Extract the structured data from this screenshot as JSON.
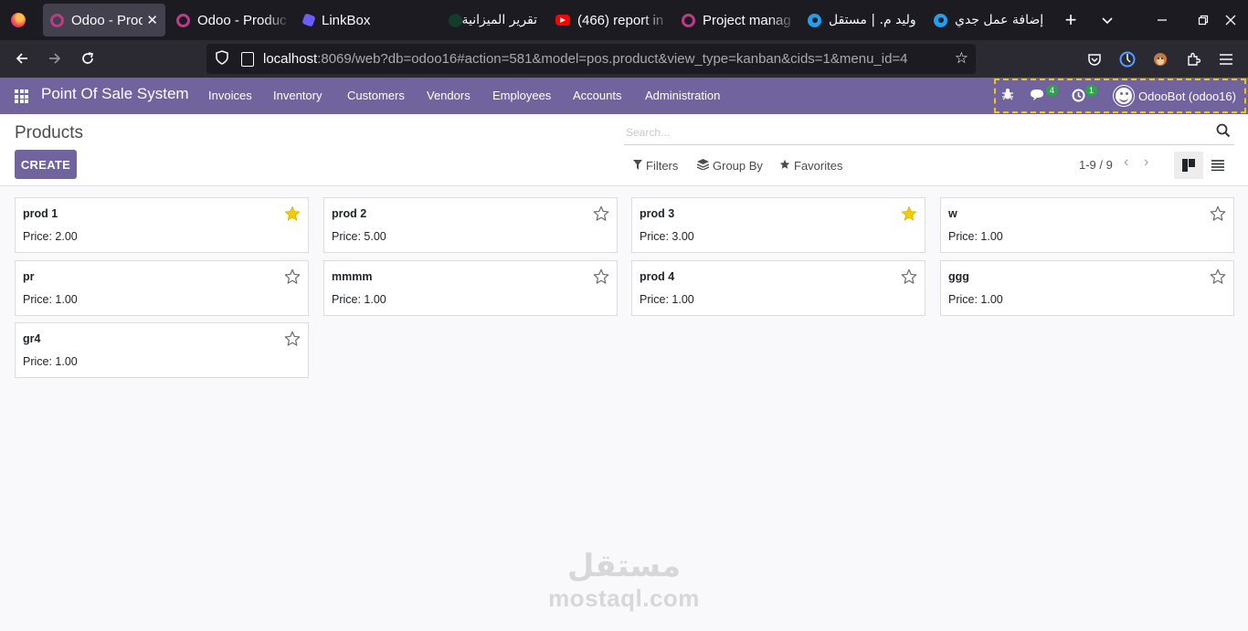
{
  "browser": {
    "tabs": [
      {
        "title": "Odoo - Prod",
        "icon": "odoo-icon",
        "active": true
      },
      {
        "title": "Odoo - Produc",
        "icon": "odoo-icon",
        "active": false
      },
      {
        "title": "LinkBox",
        "icon": "linkbox-icon",
        "active": false
      },
      {
        "title": "تقرير الميزانية",
        "icon": "sheet-icon",
        "active": false
      },
      {
        "title": "(466) report in",
        "icon": "youtube-icon",
        "active": false
      },
      {
        "title": "Project manag",
        "icon": "odoo-icon",
        "active": false
      },
      {
        "title": "وليد م. | مستقل",
        "icon": "mostaql-icon",
        "active": false
      },
      {
        "title": "إضافة عمل جدي",
        "icon": "mostaql-icon",
        "active": false
      }
    ],
    "url_host": "localhost",
    "url_rest": ":8069/web?db=odoo16#action=581&model=pos.product&view_type=kanban&cids=1&menu_id=4"
  },
  "odoo": {
    "brand": "Point Of Sale System",
    "menu": [
      "Invoices",
      "Inventory",
      "Customers",
      "Vendors",
      "Employees",
      "Accounts",
      "Administration"
    ],
    "messages_count": "4",
    "activities_count": "1",
    "user": "OdooBot (odoo16)"
  },
  "control": {
    "title": "Products",
    "create_label": "CREATE",
    "search_placeholder": "Search...",
    "filters_label": "Filters",
    "groupby_label": "Group By",
    "favorites_label": "Favorites",
    "pager": "1-9 / 9"
  },
  "products": [
    {
      "name": "prod 1",
      "price": "Price: 2.00",
      "favorite": true
    },
    {
      "name": "prod 2",
      "price": "Price: 5.00",
      "favorite": false
    },
    {
      "name": "prod 3",
      "price": "Price: 3.00",
      "favorite": true
    },
    {
      "name": "w",
      "price": "Price: 1.00",
      "favorite": false
    },
    {
      "name": "pr",
      "price": "Price: 1.00",
      "favorite": false
    },
    {
      "name": "mmmm",
      "price": "Price: 1.00",
      "favorite": false
    },
    {
      "name": "prod 4",
      "price": "Price: 1.00",
      "favorite": false
    },
    {
      "name": "ggg",
      "price": "Price: 1.00",
      "favorite": false
    },
    {
      "name": "gr4",
      "price": "Price: 1.00",
      "favorite": false
    }
  ],
  "watermark": {
    "arabic": "مستقل",
    "latin": "mostaql.com"
  },
  "colors": {
    "brand": "#71639e",
    "star_on": "#f3cc00",
    "star_off": "#6c6c6c"
  }
}
